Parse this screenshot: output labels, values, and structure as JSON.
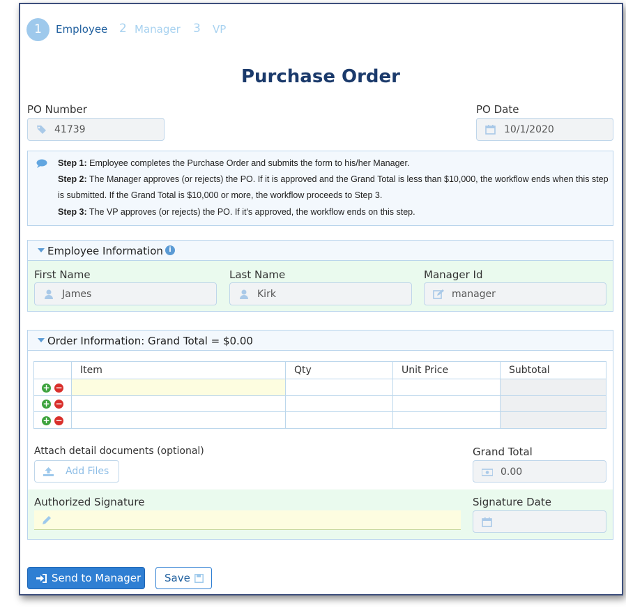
{
  "steps": [
    {
      "num": "1",
      "label": "Employee"
    },
    {
      "num": "2",
      "label": "Manager"
    },
    {
      "num": "3",
      "label": "VP"
    }
  ],
  "title": "Purchase Order",
  "po_number": {
    "label": "PO Number",
    "value": "41739"
  },
  "po_date": {
    "label": "PO Date",
    "value": "10/1/2020"
  },
  "info": {
    "step1_bold": "Step 1:",
    "step1_text": " Employee completes the Purchase Order and submits the form to his/her Manager.",
    "step2_bold": "Step 2:",
    "step2_text": " The Manager approves (or rejects) the PO. If it is approved and the Grand Total is less than $10,000, the workflow ends when this step is submitted. If the Grand Total is $10,000 or more, the workflow proceeds to Step 3.",
    "step3_bold": "Step 3:",
    "step3_text": " The VP approves (or rejects) the PO. If it's approved, the workflow ends on this step."
  },
  "employee_section": {
    "title": "Employee Information",
    "first_name": {
      "label": "First Name",
      "value": "James"
    },
    "last_name": {
      "label": "Last Name",
      "value": "Kirk"
    },
    "manager_id": {
      "label": "Manager Id",
      "value": "manager"
    }
  },
  "order_section": {
    "title": "Order Information: Grand Total = $0.00",
    "columns": [
      "Item",
      "Qty",
      "Unit Price",
      "Subtotal"
    ],
    "attach_label": "Attach detail documents (optional)",
    "add_files": "Add Files",
    "grand_total": {
      "label": "Grand Total",
      "value": "0.00"
    },
    "signature_label": "Authorized Signature",
    "signature_date_label": "Signature Date"
  },
  "buttons": {
    "send": "Send to Manager",
    "save": "Save"
  },
  "colors": {
    "accent": "#2f7fd3",
    "title": "#1b3a6b",
    "step_inactive": "#a8d2f0"
  }
}
